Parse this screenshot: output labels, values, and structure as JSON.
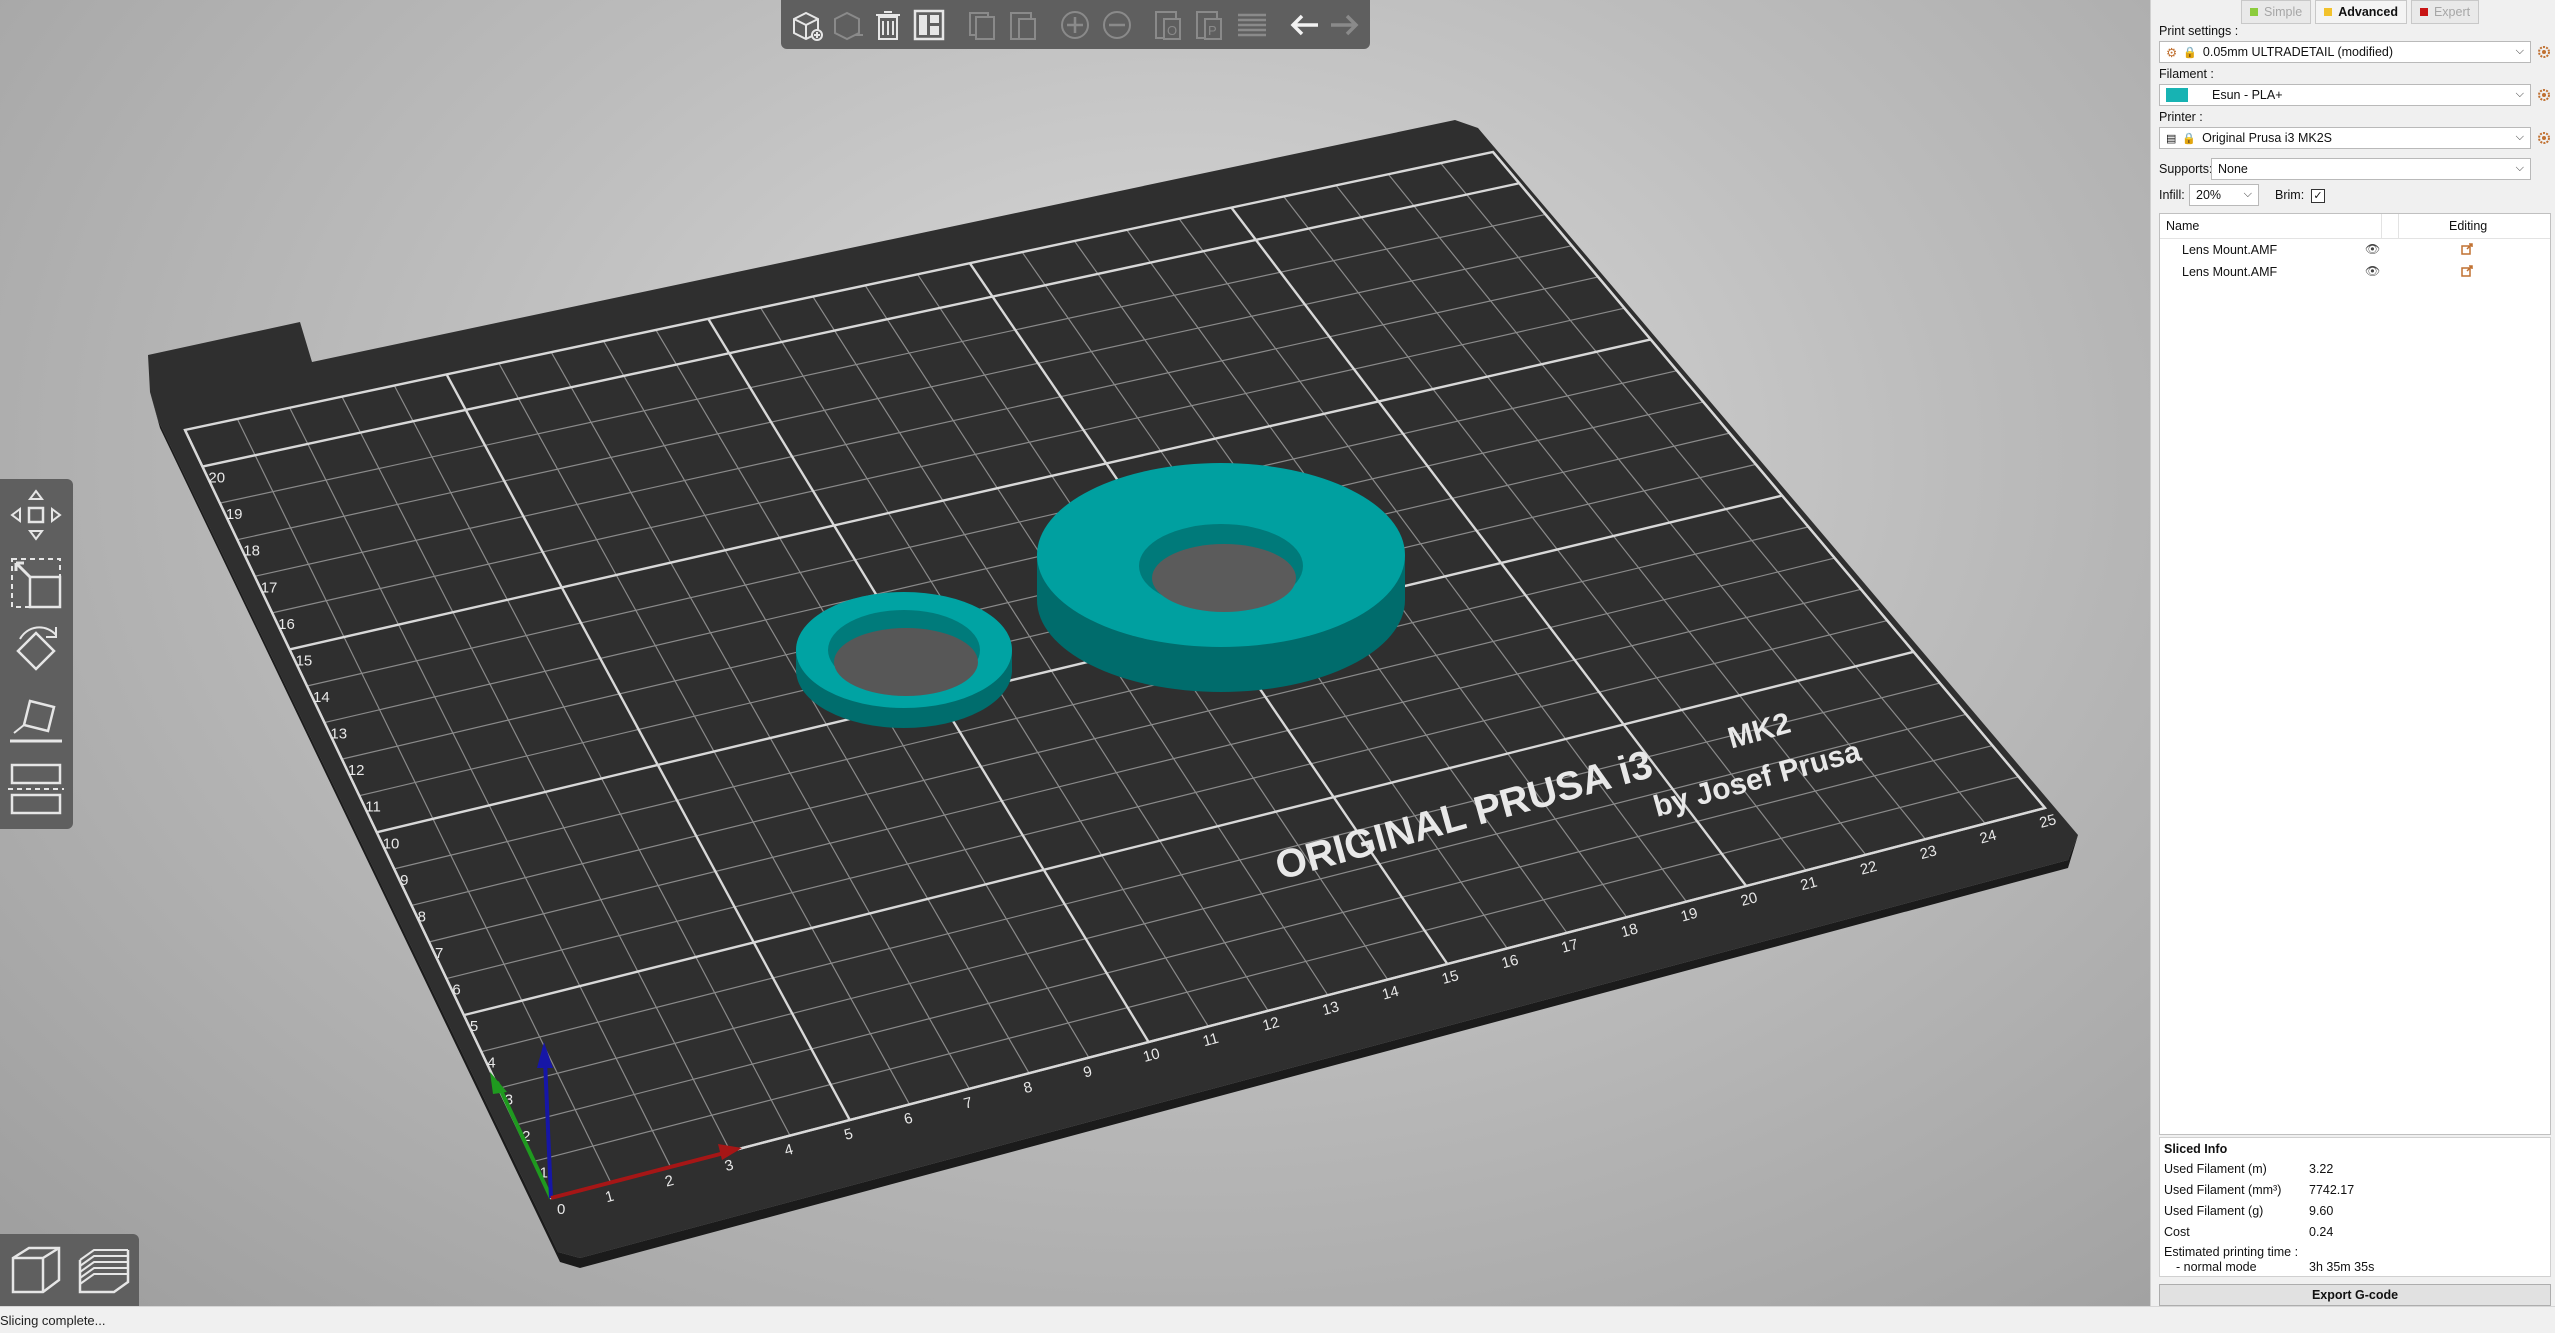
{
  "status_bar": {
    "text": "Slicing complete..."
  },
  "bed": {
    "brand_line1": "ORIGINAL PRUSA i3",
    "brand_model": "MK2",
    "brand_line2": "by Josef Prusa",
    "y_ticks": [
      "20",
      "19",
      "18",
      "17",
      "16",
      "15",
      "14",
      "13",
      "12",
      "11",
      "10",
      "9",
      "8",
      "7",
      "6",
      "5",
      "4",
      "3",
      "2",
      "1",
      "0"
    ],
    "x_ticks": [
      "1",
      "2",
      "3",
      "4",
      "5",
      "6",
      "7",
      "8",
      "9",
      "10",
      "11",
      "12",
      "13",
      "14",
      "15",
      "16",
      "17",
      "18",
      "19",
      "20",
      "21",
      "22",
      "23",
      "24",
      "25"
    ],
    "model_color": "#009b9b"
  },
  "top_toolbar": {
    "icons": [
      "add-icon",
      "delete-icon",
      "delete-all-icon",
      "arrange-icon",
      "copy-icon",
      "paste-icon",
      "add-instance-icon",
      "remove-instance-icon",
      "split-objects-icon",
      "split-parts-icon",
      "layers-editing-icon",
      "undo-icon",
      "redo-icon"
    ]
  },
  "left_toolbar": {
    "icons": [
      "move-icon",
      "scale-icon",
      "rotate-icon",
      "place-on-face-icon",
      "cut-icon"
    ]
  },
  "view_toggle": {
    "icons": [
      "3d-view-icon",
      "preview-icon"
    ]
  },
  "sidebar": {
    "modes": [
      {
        "label": "Simple",
        "color": "#8ccc3c",
        "active": false
      },
      {
        "label": "Advanced",
        "color": "#f2c22c",
        "active": true
      },
      {
        "label": "Expert",
        "color": "#c81414",
        "active": false
      }
    ],
    "print_settings_label": "Print settings :",
    "print_settings_value": "0.05mm ULTRADETAIL (modified)",
    "filament_label": "Filament :",
    "filament_value": "Esun - PLA+",
    "filament_color": "#17b3b3",
    "printer_label": "Printer :",
    "printer_value": "Original Prusa i3 MK2S",
    "supports_label": "Supports:",
    "supports_value": "None",
    "infill_label": "Infill:",
    "infill_value": "20%",
    "brim_label": "Brim:",
    "brim_checked": true,
    "objects": {
      "col_name": "Name",
      "col_editing": "Editing",
      "rows": [
        {
          "name": "Lens Mount.AMF"
        },
        {
          "name": "Lens Mount.AMF"
        }
      ]
    },
    "sliced_info": {
      "title": "Sliced Info",
      "used_filament_m_label": "Used Filament (m)",
      "used_filament_m": "3.22",
      "used_filament_mm3_label": "Used Filament (mm³)",
      "used_filament_mm3": "7742.17",
      "used_filament_g_label": "Used Filament (g)",
      "used_filament_g": "9.60",
      "cost_label": "Cost",
      "cost": "0.24",
      "est_time_label": "Estimated printing time :",
      "normal_mode_label": "- normal mode",
      "normal_mode": "3h 35m 35s"
    },
    "export_label": "Export G-code"
  }
}
